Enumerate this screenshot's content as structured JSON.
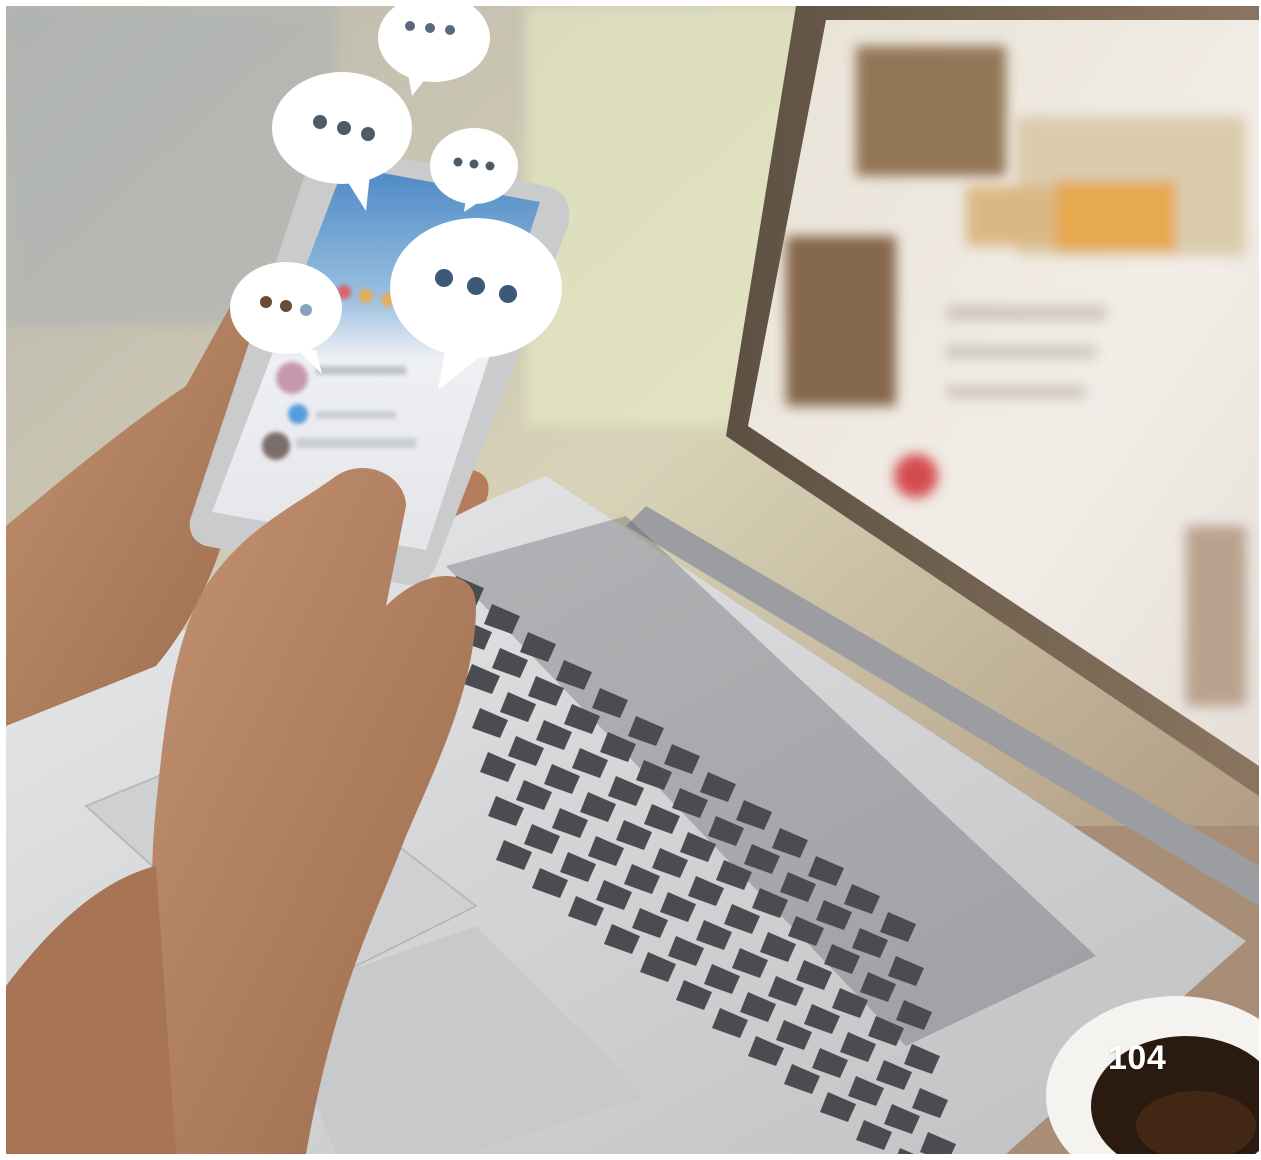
{
  "photo": {
    "subject": "hands-holding-smartphone-with-chat-bubbles-over-laptop",
    "icons": [
      "speech-bubble-icon",
      "speech-bubble-icon",
      "speech-bubble-icon",
      "speech-bubble-icon",
      "speech-bubble-icon"
    ]
  },
  "page_number": "104",
  "colors": {
    "background_warm": "#c9b9a4",
    "laptop_silver": "#d9dadb",
    "keyboard_keys": "#4a4c50",
    "skin": "#b07f60",
    "bubble": "#ffffff"
  }
}
